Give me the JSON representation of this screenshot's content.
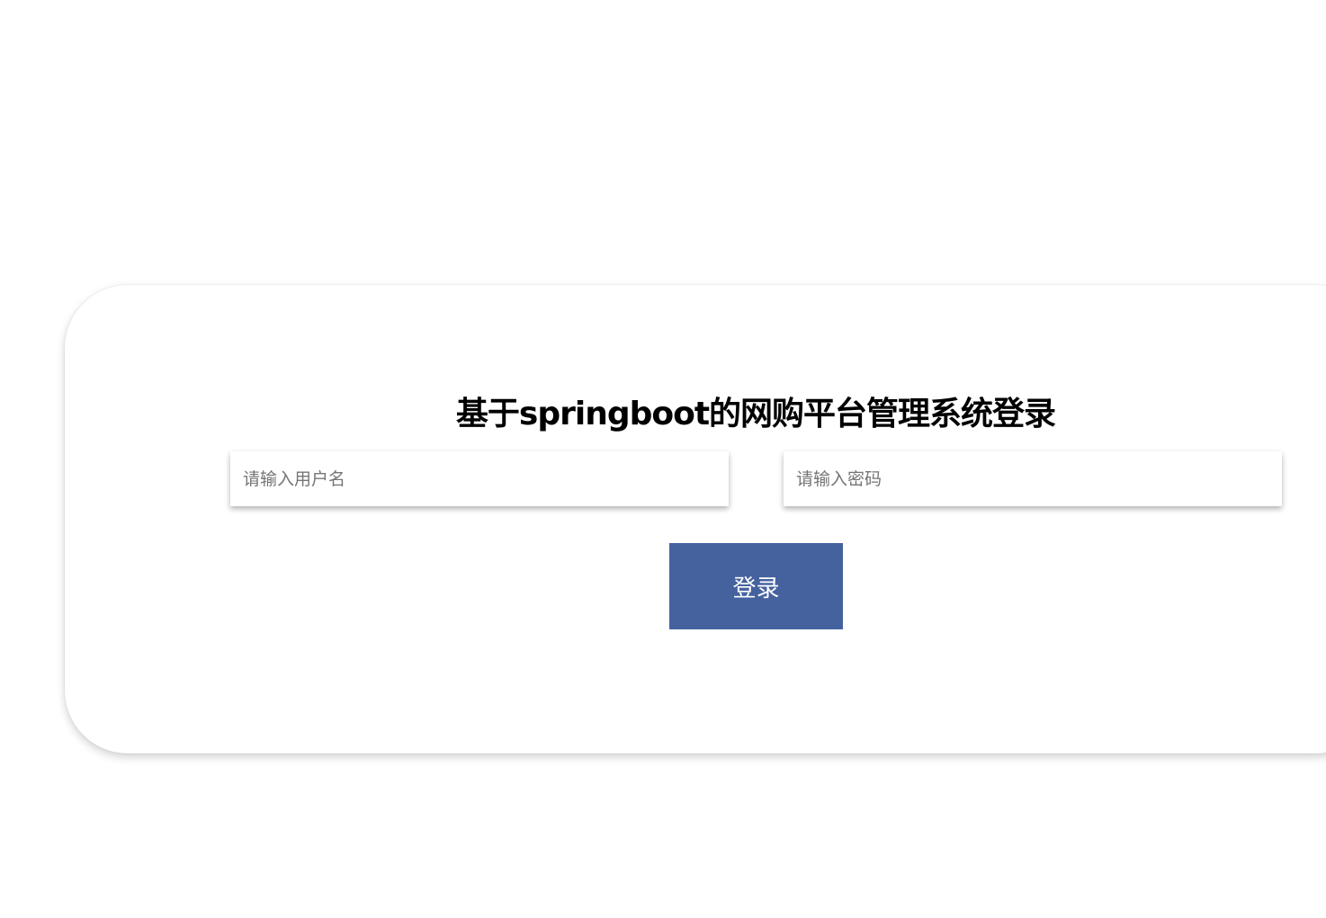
{
  "login": {
    "title": "基于springboot的网购平台管理系统登录",
    "username_placeholder": "请输入用户名",
    "password_placeholder": "请输入密码",
    "username_value": "",
    "password_value": "",
    "submit_label": "登录"
  },
  "colors": {
    "button_background": "#45629f",
    "button_text": "#ffffff",
    "title_text": "#000000",
    "placeholder_text": "#757575",
    "page_background": "#ffffff"
  }
}
